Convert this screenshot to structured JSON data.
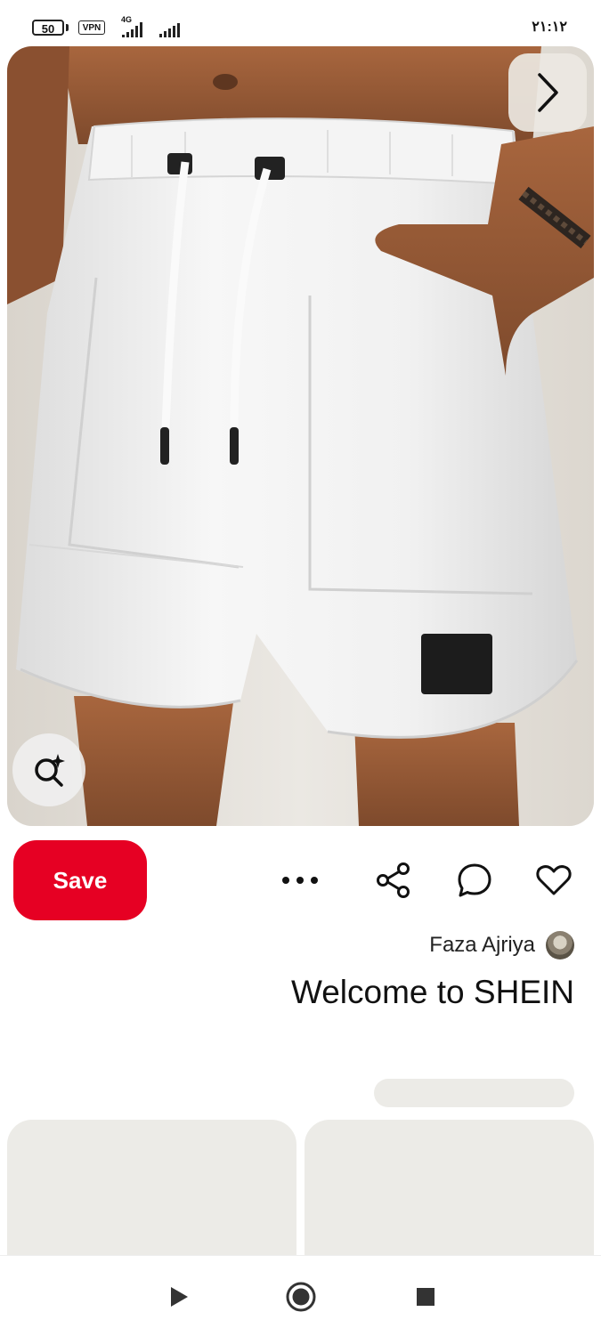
{
  "status_bar": {
    "battery": "50",
    "vpn": "VPN",
    "network": "4G",
    "time": "۲۱:۱۲"
  },
  "pin": {
    "image_icon": "product-photo",
    "next_icon": "chevron-right-icon",
    "visual_search_icon": "sparkle-search-icon",
    "author_name": "Faza Ajriya",
    "title": "Welcome to SHEIN"
  },
  "actions": {
    "save_label": "Save",
    "save_color": "#e60023",
    "icons": [
      "more-icon",
      "share-icon",
      "comment-icon",
      "heart-icon"
    ]
  },
  "nav": {
    "icons": [
      "back-triangle-icon",
      "home-circle-icon",
      "recents-square-icon"
    ]
  }
}
